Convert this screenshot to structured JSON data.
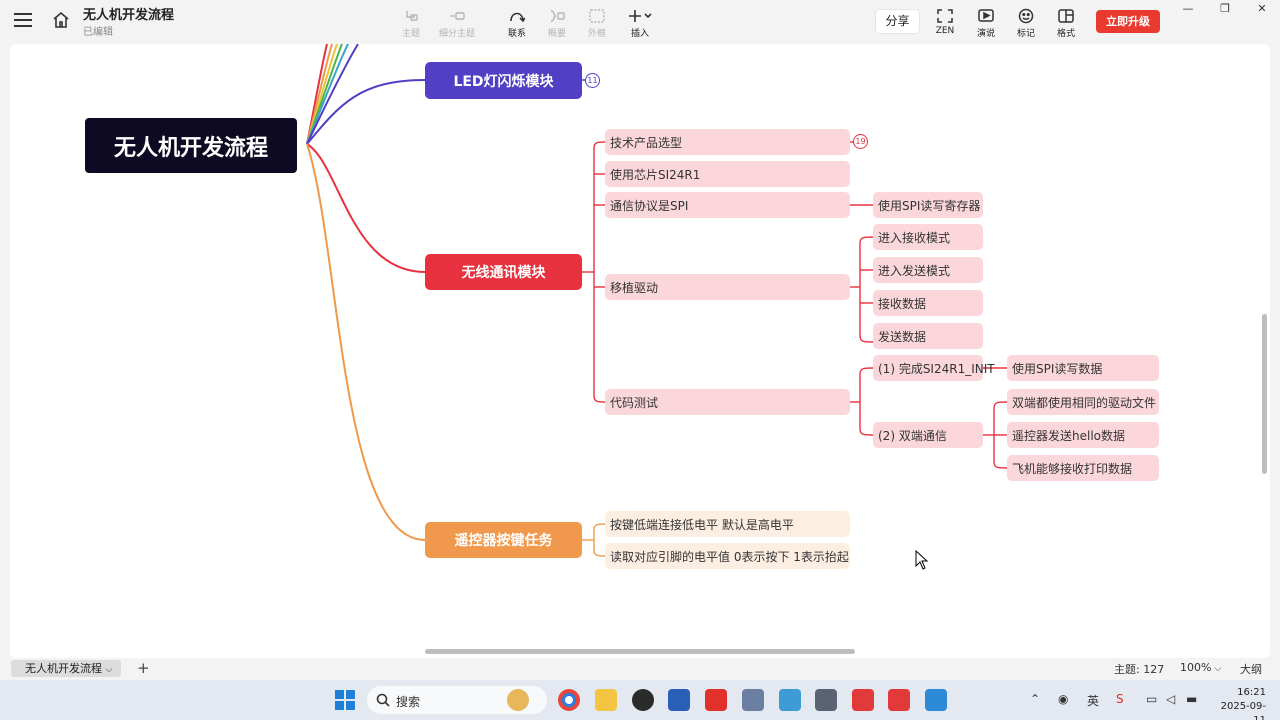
{
  "app": {
    "title": "无人机开发流程",
    "status": "已编辑"
  },
  "toolbar": {
    "tools": [
      {
        "label": "主题",
        "icon": "topic-icon",
        "enabled": false
      },
      {
        "label": "细分主题",
        "icon": "subtopic-icon",
        "enabled": false
      },
      {
        "label": "联系",
        "icon": "relationship-icon",
        "enabled": true
      },
      {
        "label": "概要",
        "icon": "summary-icon",
        "enabled": false
      },
      {
        "label": "外框",
        "icon": "boundary-icon",
        "enabled": false
      },
      {
        "label": "插入",
        "icon": "insert-icon",
        "enabled": true
      }
    ],
    "share_label": "分享",
    "right_tools": [
      {
        "label": "ZEN",
        "icon": "zen-icon"
      },
      {
        "label": "演说",
        "icon": "pitch-icon"
      },
      {
        "label": "标记",
        "icon": "marker-icon"
      },
      {
        "label": "格式",
        "icon": "format-icon"
      }
    ],
    "upgrade_label": "立即升级"
  },
  "mindmap": {
    "root": "无人机开发流程",
    "branches": [
      {
        "label": "LED灯闪烁模块",
        "color": "#5240c4",
        "badge": "11"
      },
      {
        "label": "无线通讯模块",
        "color": "#e8313f",
        "children": [
          {
            "label": "技术产品选型",
            "badge": "19"
          },
          {
            "label": "使用芯片SI24R1"
          },
          {
            "label": "通信协议是SPI",
            "children": [
              {
                "label": "使用SPI读写寄存器"
              }
            ]
          },
          {
            "label": "移植驱动",
            "children": [
              {
                "label": "进入接收模式"
              },
              {
                "label": "进入发送模式"
              },
              {
                "label": "接收数据"
              },
              {
                "label": "发送数据"
              }
            ]
          },
          {
            "label": "代码测试",
            "children": [
              {
                "label": "(1) 完成SI24R1_INIT",
                "children": [
                  {
                    "label": "使用SPI读写数据"
                  }
                ]
              },
              {
                "label": "(2) 双端通信",
                "children": [
                  {
                    "label": "双端都使用相同的驱动文件"
                  },
                  {
                    "label": "遥控器发送hello数据"
                  },
                  {
                    "label": "飞机能够接收打印数据"
                  }
                ]
              }
            ]
          }
        ]
      },
      {
        "label": "遥控器按键任务",
        "color": "#f0994d",
        "children": [
          {
            "label": "按键低端连接低电平 默认是高电平"
          },
          {
            "label": "读取对应引脚的电平值  0表示按下  1表示抬起"
          }
        ]
      }
    ]
  },
  "bottombar": {
    "sheet_tab": "无人机开发流程",
    "topic_count": "主题: 127",
    "zoom": "100%",
    "outline": "大纲"
  },
  "taskbar": {
    "search_placeholder": "搜索",
    "time": "16:21",
    "date": "2025-09-11"
  }
}
